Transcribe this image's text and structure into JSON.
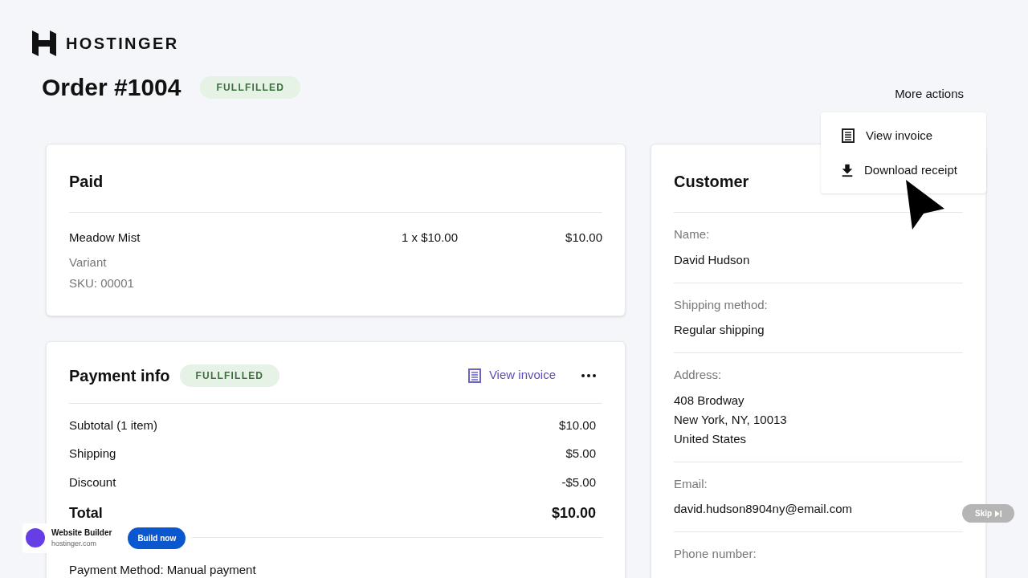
{
  "brand": {
    "name": "HOSTINGER"
  },
  "order": {
    "title": "Order #1004",
    "status": "FULLFILLED"
  },
  "more_actions": {
    "label": "More actions",
    "menu": [
      {
        "kind": "invoice",
        "label": "View invoice"
      },
      {
        "kind": "download",
        "label": "Download receipt"
      }
    ]
  },
  "paid_card": {
    "title": "Paid",
    "items": [
      {
        "name": "Meadow Mist",
        "quantity_price": "1 x $10.00",
        "total": "$10.00",
        "variant": "Variant",
        "sku": "SKU: 00001"
      }
    ]
  },
  "payment_card": {
    "title": "Payment info",
    "status": "FULLFILLED",
    "invoice_link": "View invoice",
    "rows": [
      {
        "kind": "line",
        "label": "Subtotal (1 item)",
        "value": "$10.00"
      },
      {
        "kind": "line",
        "label": "Shipping",
        "value": "$5.00"
      },
      {
        "kind": "line",
        "label": "Discount",
        "value": "-$5.00"
      },
      {
        "kind": "total",
        "label": "Total",
        "value": "$10.00"
      }
    ],
    "method": "Payment Method: Manual payment"
  },
  "customer_card": {
    "title": "Customer",
    "fields": [
      {
        "label": "Name:",
        "lines": [
          "David Hudson"
        ]
      },
      {
        "label": "Shipping method:",
        "lines": [
          "Regular shipping"
        ]
      },
      {
        "label": "Address:",
        "lines": [
          "408 Brodway",
          "New York, NY, 10013",
          "United States"
        ]
      },
      {
        "label": "Email:",
        "lines": [
          "david.hudson8904ny@email.com"
        ]
      },
      {
        "label": "Phone number:"
      }
    ]
  },
  "ad": {
    "title": "Website Builder",
    "domain": "hostinger.com",
    "button": "Build now",
    "skip": "Skip"
  }
}
